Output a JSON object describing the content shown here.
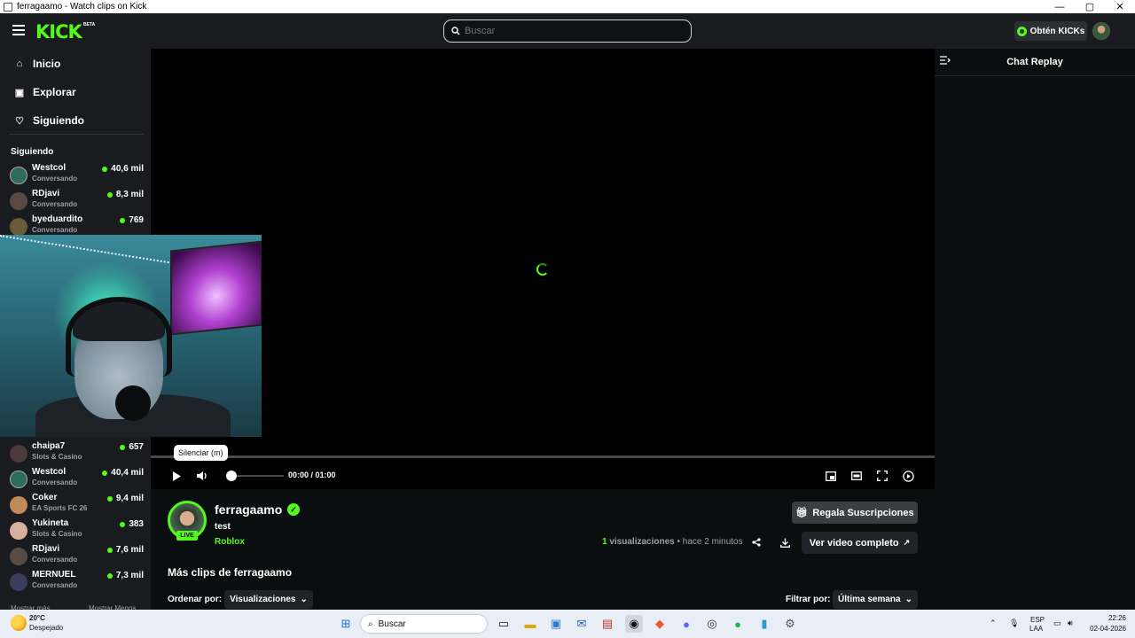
{
  "window": {
    "title": "ferragaamo - Watch clips on Kick",
    "controls": [
      "—",
      "▢",
      "✕"
    ]
  },
  "header": {
    "logo": "KICK",
    "logo_badge": "BETA",
    "search_placeholder": "Buscar",
    "kicks_label": "Obtén KICKs"
  },
  "sidebar": {
    "nav": [
      {
        "label": "Inicio",
        "icon": "home-icon"
      },
      {
        "label": "Explorar",
        "icon": "explore-icon"
      },
      {
        "label": "Siguiendo",
        "icon": "heart-icon"
      }
    ],
    "section_title": "Siguiendo",
    "channels": [
      {
        "name": "Westcol",
        "category": "Conversando",
        "viewers": "40,6 mil"
      },
      {
        "name": "RDjavi",
        "category": "Conversando",
        "viewers": "8,3 mil"
      },
      {
        "name": "byeduardito",
        "category": "Conversando",
        "viewers": "769"
      },
      {
        "name": "chaipa7",
        "category": "Slots & Casino",
        "viewers": "657"
      },
      {
        "name": "Westcol",
        "category": "Conversando",
        "viewers": "40,4 mil"
      },
      {
        "name": "Coker",
        "category": "EA Sports FC 26",
        "viewers": "9,4 mil"
      },
      {
        "name": "Yukineta",
        "category": "Slots & Casino",
        "viewers": "383"
      },
      {
        "name": "RDjavi",
        "category": "Conversando",
        "viewers": "7,6 mil"
      },
      {
        "name": "MERNUEL",
        "category": "Conversando",
        "viewers": "7,3 mil"
      }
    ],
    "show_more": "Mostrar más",
    "show_less": "Mostrar Menos"
  },
  "player": {
    "tooltip": "Silenciar (m)",
    "time": "00:00 / 01:00",
    "volume": 0.0,
    "progress": 0.0
  },
  "clip": {
    "channel_name": "ferragaamo",
    "live_badge": "LIVE",
    "title": "test",
    "category": "Roblox",
    "views_count": "1",
    "views_label": "visualizaciones",
    "separator": "•",
    "posted": "hace 2 minutos",
    "gift_label": "Regala Suscripciones",
    "full_video_label": "Ver video completo"
  },
  "more_clips": {
    "title": "Más clips de ferragaamo",
    "order_label": "Ordenar por:",
    "order_value": "Visualizaciones",
    "filter_label": "Filtrar por:",
    "filter_value": "Última semana"
  },
  "chat": {
    "title": "Chat Replay"
  },
  "taskbar": {
    "weather_temp": "20°C",
    "weather_desc": "Despejado",
    "search_label": "Buscar",
    "lang_top": "ESP",
    "lang_bottom": "LAA",
    "time": "22:26",
    "date": "02-04-2026"
  },
  "colors": {
    "accent": "#53fc18",
    "background": "#0b0e0f",
    "panel": "#191b1f"
  }
}
